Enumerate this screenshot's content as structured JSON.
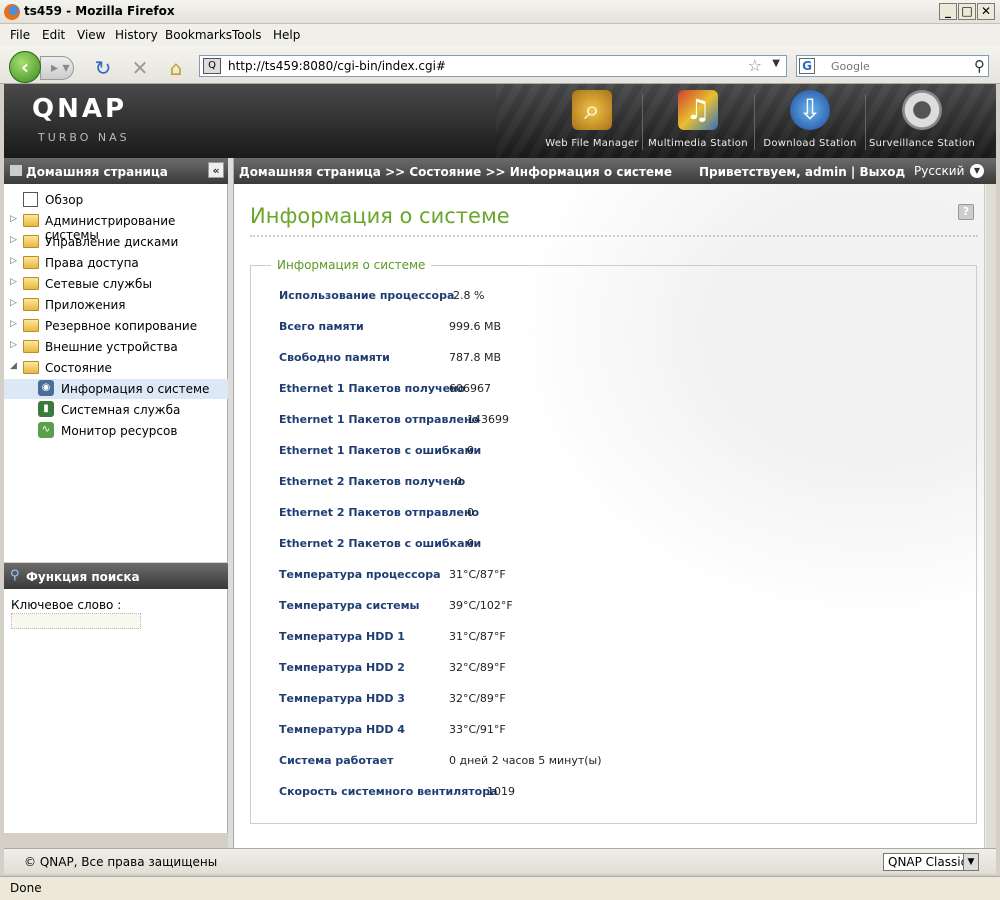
{
  "window": {
    "title": "ts459 - Mozilla Firefox"
  },
  "menu": {
    "items": [
      "File",
      "Edit",
      "View",
      "History",
      "Bookmarks",
      "Tools",
      "Help"
    ]
  },
  "navbar": {
    "url": "http://ts459:8080/cgi-bin/index.cgi#",
    "search_placeholder": "Google"
  },
  "banner": {
    "logo": "QNAP",
    "subtitle": "TURBO NAS",
    "apps": [
      {
        "label": "Web File Manager",
        "icon": "folder-magnifier-icon"
      },
      {
        "label": "Multimedia Station",
        "icon": "multimedia-icon"
      },
      {
        "label": "Download Station",
        "icon": "download-globe-icon"
      },
      {
        "label": "Surveillance Station",
        "icon": "camera-icon"
      }
    ]
  },
  "sidebar": {
    "title": "Домашняя страница",
    "items": [
      {
        "label": "Обзор"
      },
      {
        "label": "Администрирование системы"
      },
      {
        "label": "Управление дисками"
      },
      {
        "label": "Права доступа"
      },
      {
        "label": "Сетевые службы"
      },
      {
        "label": "Приложения"
      },
      {
        "label": "Резервное копирование"
      },
      {
        "label": "Внешние устройства"
      },
      {
        "label": "Состояние"
      },
      {
        "label": "Информация о системе"
      },
      {
        "label": "Системная служба"
      },
      {
        "label": "Монитор ресурсов"
      }
    ]
  },
  "search_panel": {
    "title": "Функция поиска",
    "keyword_label": "Ключевое слово :"
  },
  "header": {
    "breadcrumb": "Домашняя страница >> Состояние >> Информация о системе",
    "welcome": "Приветствуем,  admin | Выход",
    "language": "Русский"
  },
  "main": {
    "title": "Информация о системе",
    "section_title": "Информация о системе",
    "rows": [
      {
        "key": "Использование процессора",
        "value": "2.8 %"
      },
      {
        "key": "Всего памяти",
        "value": "999.6 MB"
      },
      {
        "key": "Свободно памяти",
        "value": "787.8 MB"
      },
      {
        "key": "Ethernet 1 Пакетов получено",
        "value": "606967"
      },
      {
        "key": "Ethernet 1 Пакетов отправлено",
        "value": "143699"
      },
      {
        "key": "Ethernet 1 Пакетов с ошибками",
        "value": "0"
      },
      {
        "key": "Ethernet 2 Пакетов получено",
        "value": "0"
      },
      {
        "key": "Ethernet 2 Пакетов отправлено",
        "value": "0"
      },
      {
        "key": "Ethernet 2 Пакетов с ошибками",
        "value": "0"
      },
      {
        "key": "Температура процессора",
        "value": "31°C/87°F"
      },
      {
        "key": "Температура системы",
        "value": "39°C/102°F"
      },
      {
        "key": "Температура HDD 1",
        "value": "31°C/87°F"
      },
      {
        "key": "Температура HDD 2",
        "value": "32°C/89°F"
      },
      {
        "key": "Температура HDD 3",
        "value": "32°C/89°F"
      },
      {
        "key": "Температура HDD 4",
        "value": "33°C/91°F"
      },
      {
        "key": "Система работает",
        "value": "0 дней 2 часов 5 минут(ы)"
      },
      {
        "key": "Скорость системного вентилятора",
        "value": "1019"
      }
    ]
  },
  "footer": {
    "copyright": "© QNAP, Все права защищены",
    "theme": "QNAP Classic"
  },
  "status": {
    "text": "Done"
  }
}
